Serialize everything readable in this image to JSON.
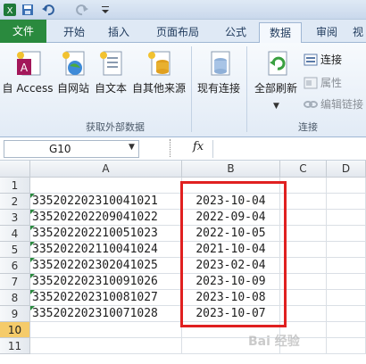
{
  "quick_access": {
    "app_icon": "excel-icon",
    "save_icon": "save-icon",
    "undo_icon": "undo-icon",
    "redo_icon": "redo-icon",
    "customize_icon": "customize-icon"
  },
  "tabs": [
    {
      "label": "文件"
    },
    {
      "label": "开始"
    },
    {
      "label": "插入"
    },
    {
      "label": "页面布局"
    },
    {
      "label": "公式"
    },
    {
      "label": "数据"
    },
    {
      "label": "审阅"
    },
    {
      "label": "视"
    }
  ],
  "ribbon": {
    "external_group": "获取外部数据",
    "connections_group": "连接",
    "from_access": "自 Access",
    "from_web": "自网站",
    "from_text": "自文本",
    "from_other": "自其他来源",
    "existing": "现有连接",
    "refresh_all": "全部刷新",
    "connections": "连接",
    "properties": "属性",
    "edit_links": "编辑链接"
  },
  "formula_bar": {
    "name_box": "G10",
    "fx": "fx"
  },
  "columns": [
    "A",
    "B",
    "C",
    "D"
  ],
  "rows": [
    {
      "num": "1",
      "a": "",
      "b": ""
    },
    {
      "num": "2",
      "a": "335202202310041021",
      "b": "2023-10-04"
    },
    {
      "num": "3",
      "a": "335202202209041022",
      "b": "2022-09-04"
    },
    {
      "num": "4",
      "a": "335202202210051023",
      "b": "2022-10-05"
    },
    {
      "num": "5",
      "a": "335202202110041024",
      "b": "2021-10-04"
    },
    {
      "num": "6",
      "a": "335202202302041025",
      "b": "2023-02-04"
    },
    {
      "num": "7",
      "a": "335202202310091026",
      "b": "2023-10-09"
    },
    {
      "num": "8",
      "a": "335202202310081027",
      "b": "2023-10-08"
    },
    {
      "num": "9",
      "a": "335202202310071028",
      "b": "2023-10-07"
    },
    {
      "num": "10",
      "a": "",
      "b": ""
    },
    {
      "num": "11",
      "a": "",
      "b": ""
    }
  ],
  "watermark": "Bai 经验",
  "colors": {
    "file_tab": "#2a8a3e",
    "highlight_box": "#e02020",
    "selected_row": "#f5cb6a"
  }
}
